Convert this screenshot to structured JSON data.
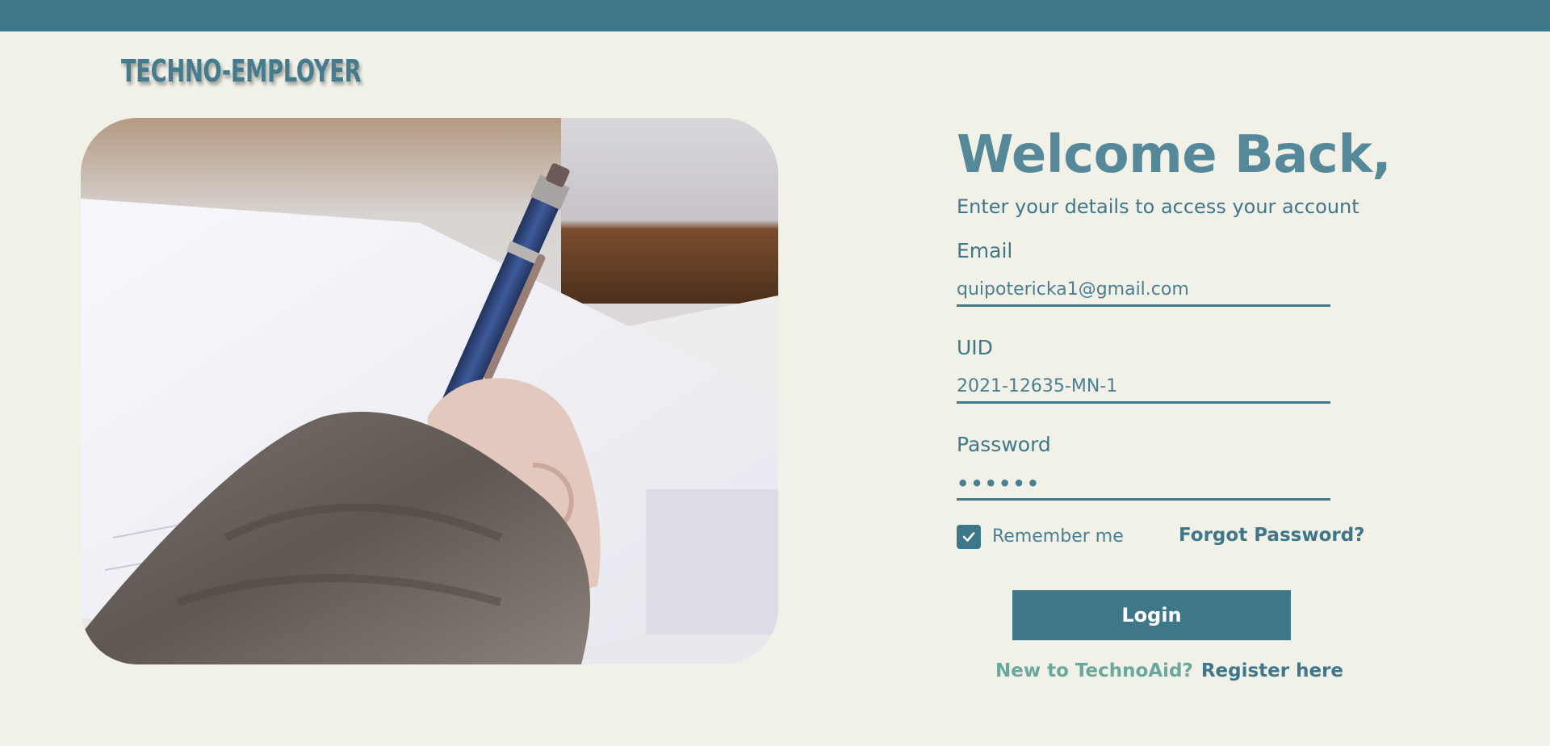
{
  "brand": "TECHNO-EMPLOYER",
  "hero": {
    "alt": "hand-writing-with-pen"
  },
  "form": {
    "title": "Welcome Back,",
    "subtitle": "Enter your details to access your account",
    "email": {
      "label": "Email",
      "value": "quipotericka1@gmail.com"
    },
    "uid": {
      "label": "UID",
      "value": "2021-12635-MN-1"
    },
    "password": {
      "label": "Password",
      "value": "••••••"
    },
    "remember": {
      "label": "Remember me",
      "checked": true
    },
    "forgot_label": "Forgot Password?",
    "login_label": "Login",
    "register": {
      "question": "New to TechnoAid?",
      "link_label": "Register here"
    }
  },
  "colors": {
    "accent": "#3e7789",
    "background": "#f2f1e8",
    "title": "#55899a",
    "muted_green": "#6aa79c"
  },
  "icons": {
    "checkbox": "check-icon"
  }
}
